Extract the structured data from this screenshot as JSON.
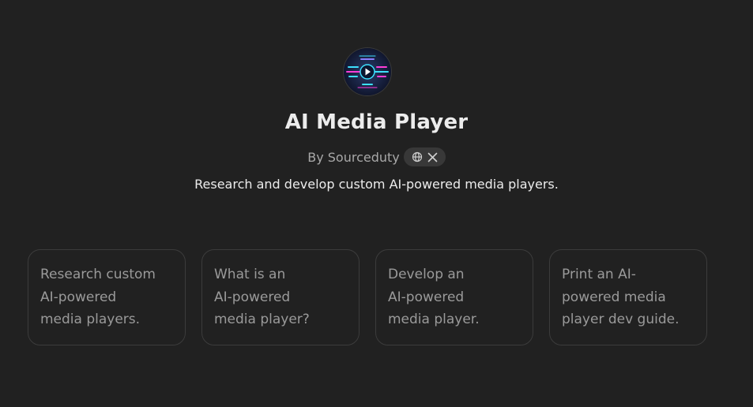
{
  "gpt": {
    "name": "AI Media Player",
    "author_prefix": "By Sourceduty",
    "description": "Research and develop custom AI-powered media players.",
    "links": [
      "globe-icon",
      "x-logo-icon"
    ]
  },
  "starters": [
    {
      "lines": [
        "Research custom",
        "AI-powered",
        "media players."
      ]
    },
    {
      "lines": [
        "What is an",
        "AI-powered",
        "media player?"
      ]
    },
    {
      "lines": [
        "Develop an",
        "AI-powered",
        "media player."
      ]
    },
    {
      "lines": [
        "Print an AI-",
        "powered media",
        "player dev guide."
      ]
    }
  ],
  "colors": {
    "background": "#212121",
    "card_border": "#3c3c3c",
    "muted_text": "#9a9a9a",
    "accent_cyan": "#3de0ff",
    "accent_magenta": "#ff3dd8"
  }
}
